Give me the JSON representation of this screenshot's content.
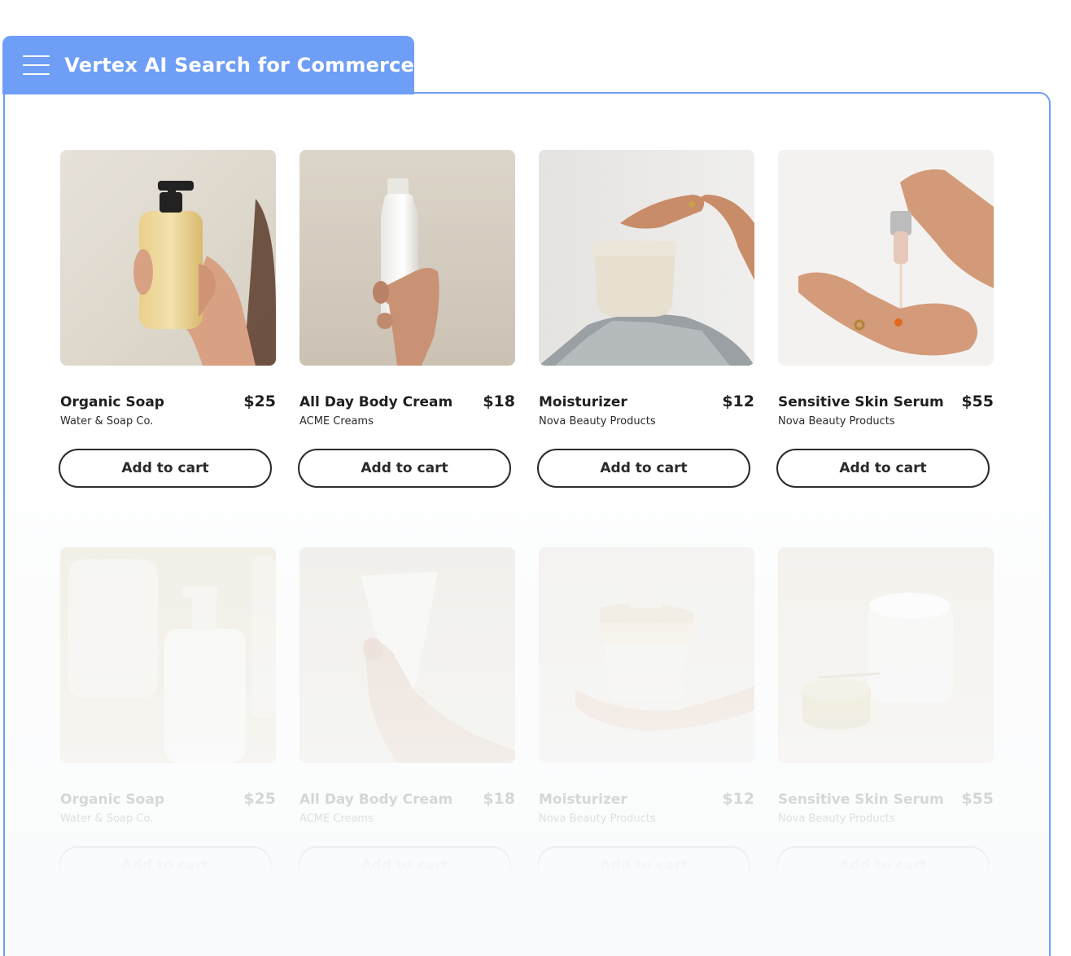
{
  "app": {
    "title": "Vertex AI Search for Commerce",
    "menu_icon": "hamburger-menu-icon",
    "accent_color": "#6e9ef6"
  },
  "products": [
    {
      "row": [
        {
          "name": "Organic Soap",
          "price": "$25",
          "brand": "Water & Soap Co.",
          "button": "Add to cart",
          "image": "amber-pump-bottle-in-hand"
        },
        {
          "name": "All Day Body Cream",
          "price": "$18",
          "brand": "ACME Creams",
          "button": "Add to cart",
          "image": "white-bottle-in-hand"
        },
        {
          "name": "Moisturizer",
          "price": "$12",
          "brand": "Nova Beauty Products",
          "button": "Add to cart",
          "image": "cream-jar-on-knee"
        },
        {
          "name": "Sensitive Skin Serum",
          "price": "$55",
          "brand": "Nova Beauty Products",
          "button": "Add to cart",
          "image": "serum-dropper-over-palm"
        }
      ]
    },
    {
      "row": [
        {
          "name": "Organic Soap",
          "price": "$25",
          "brand": "Water & Soap Co.",
          "button": "Add to cart",
          "image": "white-pump-bottles"
        },
        {
          "name": "All Day Body Cream",
          "price": "$18",
          "brand": "ACME Creams",
          "button": "Add to cart",
          "image": "cream-tube-in-hand"
        },
        {
          "name": "Moisturizer",
          "price": "$12",
          "brand": "Nova Beauty Products",
          "button": "Add to cart",
          "image": "jar-with-brush-on-palm"
        },
        {
          "name": "Sensitive Skin Serum",
          "price": "$55",
          "brand": "Nova Beauty Products",
          "button": "Add to cart",
          "image": "open-cream-jar-with-gold-lid"
        }
      ]
    }
  ]
}
